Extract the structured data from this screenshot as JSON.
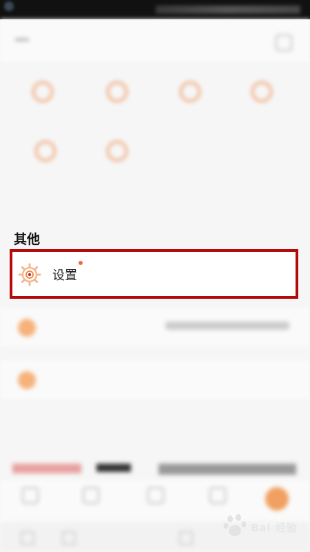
{
  "section": {
    "title": "其他"
  },
  "settings_item": {
    "label": "设置",
    "has_badge": true,
    "icon": "gear-icon",
    "highlight_color": "#b30a0a"
  },
  "watermark": {
    "text": "Bai  经验"
  },
  "colors": {
    "accent": "#f26a3b",
    "highlight": "#b30a0a"
  }
}
